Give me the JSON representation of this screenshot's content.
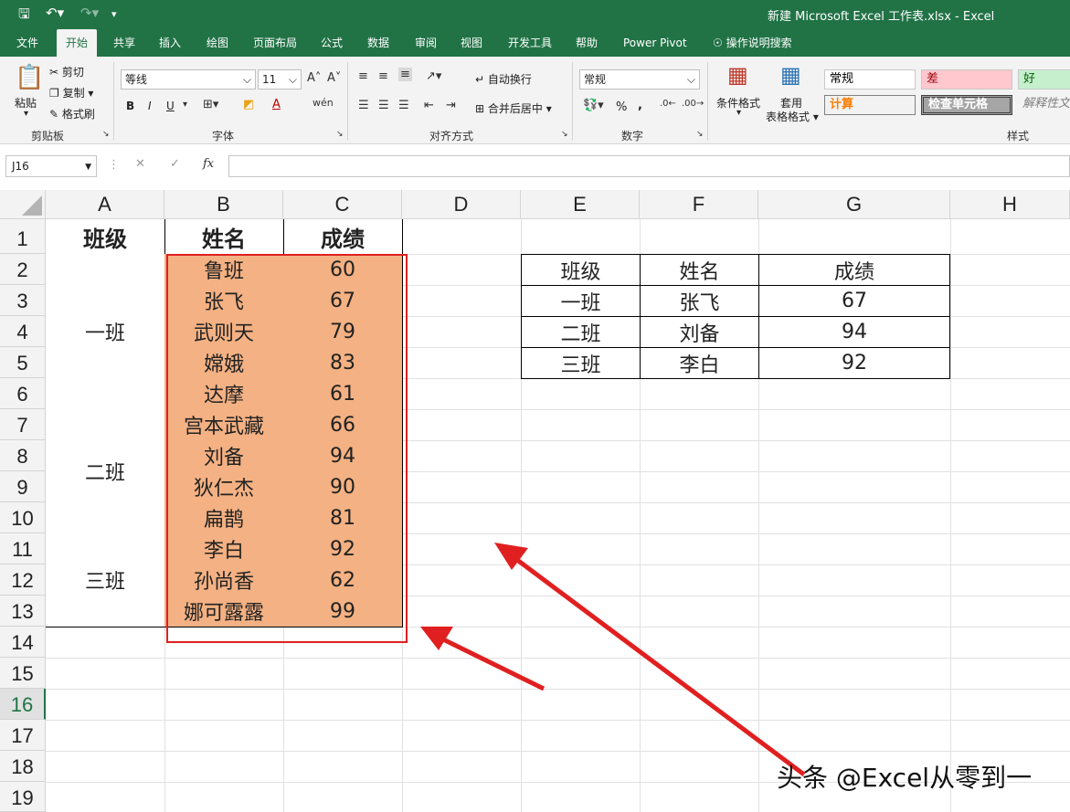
{
  "window": {
    "title": "新建 Microsoft Excel 工作表.xlsx  -  Excel"
  },
  "tabs": [
    "文件",
    "开始",
    "共享",
    "插入",
    "绘图",
    "页面布局",
    "公式",
    "数据",
    "审阅",
    "视图",
    "开发工具",
    "帮助",
    "Power Pivot",
    "操作说明搜索"
  ],
  "ribbon": {
    "clipboard": {
      "paste": "粘贴",
      "cut": "剪切",
      "copy": "复制",
      "format_painter": "格式刷",
      "label": "剪贴板"
    },
    "font": {
      "name": "等线",
      "size": "11",
      "bold": "B",
      "italic": "I",
      "underline": "U",
      "label": "字体"
    },
    "alignment": {
      "wrap": "自动换行",
      "merge": "合并后居中",
      "label": "对齐方式"
    },
    "number": {
      "format": "常规",
      "percent": "%",
      "comma": ",",
      "label": "数字"
    },
    "styles": {
      "cond_format": "条件格式",
      "table_format_1": "套用",
      "table_format_2": "表格格式",
      "normal": "常规",
      "bad": "差",
      "good": "好",
      "calc": "计算",
      "check": "检查单元格",
      "explain": "解释性文",
      "label": "样式"
    }
  },
  "formula_bar": {
    "name_box": "J16",
    "fx": "fx",
    "value": ""
  },
  "columns": [
    "A",
    "B",
    "C",
    "D",
    "E",
    "F",
    "G",
    "H"
  ],
  "rows": [
    "1",
    "2",
    "3",
    "4",
    "5",
    "6",
    "7",
    "8",
    "9",
    "10",
    "11",
    "12",
    "13",
    "14",
    "15",
    "16",
    "17",
    "18",
    "19"
  ],
  "selected_row": "16",
  "table1": {
    "headers": [
      "班级",
      "姓名",
      "成绩"
    ],
    "classes": [
      "一班",
      "二班",
      "三班"
    ],
    "records": [
      [
        "鲁班",
        "60"
      ],
      [
        "张飞",
        "67"
      ],
      [
        "武则天",
        "79"
      ],
      [
        "嫦娥",
        "83"
      ],
      [
        "达摩",
        "61"
      ],
      [
        "宫本武藏",
        "66"
      ],
      [
        "刘备",
        "94"
      ],
      [
        "狄仁杰",
        "90"
      ],
      [
        "扁鹊",
        "81"
      ],
      [
        "李白",
        "92"
      ],
      [
        "孙尚香",
        "62"
      ],
      [
        "娜可露露",
        "99"
      ]
    ]
  },
  "table2": {
    "headers": [
      "班级",
      "姓名",
      "成绩"
    ],
    "rows": [
      [
        "一班",
        "张飞",
        "67"
      ],
      [
        "二班",
        "刘备",
        "94"
      ],
      [
        "三班",
        "李白",
        "92"
      ]
    ]
  },
  "watermark": "头条 @Excel从零到一",
  "colors": {
    "excel_green": "#217346",
    "highlight": "#f4b183",
    "annotation_red": "#e02020"
  }
}
